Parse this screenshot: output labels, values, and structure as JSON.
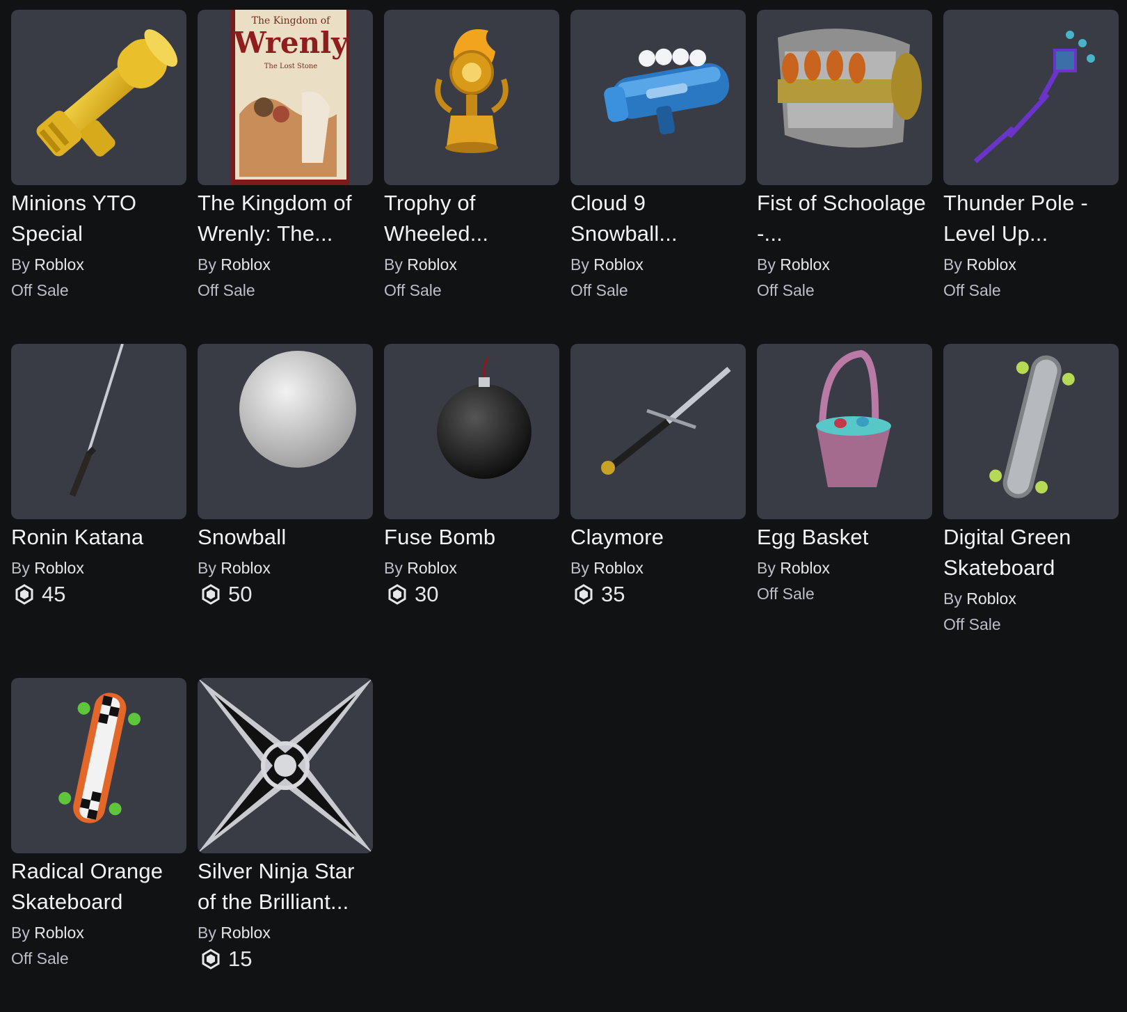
{
  "items": [
    {
      "name": "Minions YTO Special",
      "by_prefix": "By",
      "creator": "Roblox",
      "status": "Off Sale",
      "price": null,
      "icon": "minions-blaster-icon"
    },
    {
      "name": "The Kingdom of Wrenly: The...",
      "by_prefix": "By",
      "creator": "Roblox",
      "status": "Off Sale",
      "price": null,
      "icon": "book-icon",
      "cover_title": "Wrenly",
      "cover_top": "The Kingdom of",
      "cover_sub": "The Lost Stone"
    },
    {
      "name": "Trophy of Wheeled...",
      "by_prefix": "By",
      "creator": "Roblox",
      "status": "Off Sale",
      "price": null,
      "icon": "trophy-icon"
    },
    {
      "name": "Cloud 9 Snowball...",
      "by_prefix": "By",
      "creator": "Roblox",
      "status": "Off Sale",
      "price": null,
      "icon": "snowball-launcher-icon"
    },
    {
      "name": "Fist of Schoolage -...",
      "by_prefix": "By",
      "creator": "Roblox",
      "status": "Off Sale",
      "price": null,
      "icon": "fist-icon"
    },
    {
      "name": "Thunder Pole - Level Up...",
      "by_prefix": "By",
      "creator": "Roblox",
      "status": "Off Sale",
      "price": null,
      "icon": "thunder-pole-icon"
    },
    {
      "name": "Ronin Katana",
      "by_prefix": "By",
      "creator": "Roblox",
      "status": null,
      "price": "45",
      "icon": "katana-icon"
    },
    {
      "name": "Snowball",
      "by_prefix": "By",
      "creator": "Roblox",
      "status": null,
      "price": "50",
      "icon": "snowball-icon"
    },
    {
      "name": "Fuse Bomb",
      "by_prefix": "By",
      "creator": "Roblox",
      "status": null,
      "price": "30",
      "icon": "bomb-icon"
    },
    {
      "name": "Claymore",
      "by_prefix": "By",
      "creator": "Roblox",
      "status": null,
      "price": "35",
      "icon": "sword-icon"
    },
    {
      "name": "Egg Basket",
      "by_prefix": "By",
      "creator": "Roblox",
      "status": "Off Sale",
      "price": null,
      "icon": "egg-basket-icon"
    },
    {
      "name": "Digital Green Skateboard",
      "by_prefix": "By",
      "creator": "Roblox",
      "status": "Off Sale",
      "price": null,
      "icon": "skateboard-green-icon"
    },
    {
      "name": "Radical Orange Skateboard",
      "by_prefix": "By",
      "creator": "Roblox",
      "status": "Off Sale",
      "price": null,
      "icon": "skateboard-orange-icon"
    },
    {
      "name": "Silver Ninja Star of the Brilliant...",
      "by_prefix": "By",
      "creator": "Roblox",
      "status": null,
      "price": "15",
      "icon": "ninja-star-icon"
    }
  ],
  "colors": {
    "background": "#111214",
    "card": "#393b45",
    "text_primary": "#f2f3f5",
    "text_secondary": "#bcbec8"
  },
  "currency_icon": "robux-icon"
}
